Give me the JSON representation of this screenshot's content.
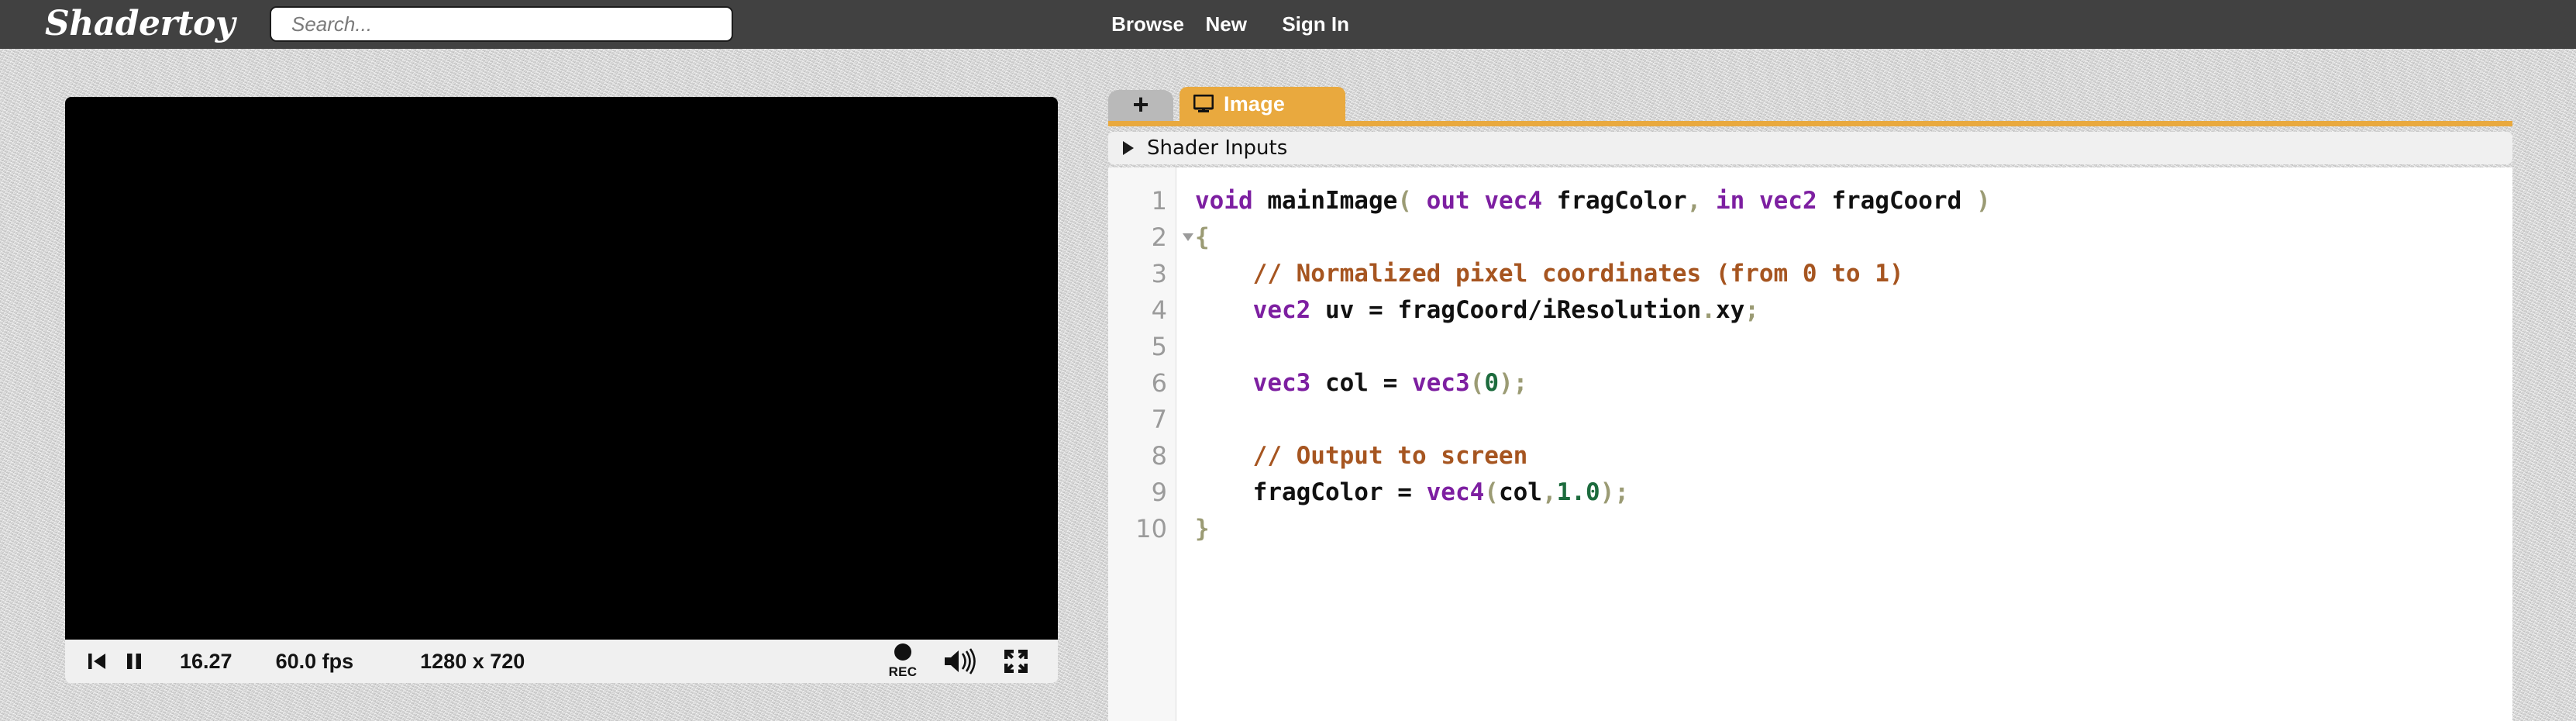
{
  "header": {
    "logo": "Shadertoy",
    "search": {
      "placeholder": "Search...",
      "value": ""
    },
    "nav": [
      {
        "label": "Browse",
        "name": "nav-browse"
      },
      {
        "label": "New",
        "name": "nav-new"
      },
      {
        "label": "Sign In",
        "name": "nav-signin"
      }
    ]
  },
  "preview": {
    "canvas_color": "#000000",
    "player": {
      "rewind_icon": "skip-back-icon",
      "pause_icon": "pause-icon",
      "time": "16.27",
      "fps": "60.0 fps",
      "resolution": "1280 x 720",
      "record_label": "REC",
      "record_icon": "record-icon",
      "volume_icon": "volume-icon",
      "fullscreen_icon": "fullscreen-icon"
    }
  },
  "code_panel": {
    "add_tab_label": "+",
    "tabs": [
      {
        "label": "Image",
        "icon": "monitor-icon",
        "active": true
      }
    ],
    "shader_inputs": {
      "label": "Shader Inputs",
      "arrow_icon": "triangle-right-icon",
      "expanded": false
    },
    "accent_color": "#e9a93e",
    "editor": {
      "line_numbers": [
        "1",
        "2",
        "3",
        "4",
        "5",
        "6",
        "7",
        "8",
        "9",
        "10"
      ],
      "fold_line": "2",
      "lines": [
        {
          "n": "1",
          "tokens": [
            {
              "t": "void",
              "c": "kw"
            },
            {
              "t": " ",
              "c": "op"
            },
            {
              "t": "mainImage",
              "c": "fn"
            },
            {
              "t": "(",
              "c": "punc"
            },
            {
              "t": " ",
              "c": "op"
            },
            {
              "t": "out",
              "c": "kw"
            },
            {
              "t": " ",
              "c": "op"
            },
            {
              "t": "vec4",
              "c": "kw"
            },
            {
              "t": " ",
              "c": "op"
            },
            {
              "t": "fragColor",
              "c": "fn"
            },
            {
              "t": ",",
              "c": "punc"
            },
            {
              "t": " ",
              "c": "op"
            },
            {
              "t": "in",
              "c": "kw"
            },
            {
              "t": " ",
              "c": "op"
            },
            {
              "t": "vec2",
              "c": "kw"
            },
            {
              "t": " ",
              "c": "op"
            },
            {
              "t": "fragCoord",
              "c": "fn"
            },
            {
              "t": " ",
              "c": "op"
            },
            {
              "t": ")",
              "c": "punc"
            }
          ]
        },
        {
          "n": "2",
          "tokens": [
            {
              "t": "{",
              "c": "punc"
            }
          ]
        },
        {
          "n": "3",
          "tokens": [
            {
              "t": "    // Normalized pixel coordinates (from 0 to 1)",
              "c": "comment"
            }
          ]
        },
        {
          "n": "4",
          "tokens": [
            {
              "t": "    ",
              "c": "op"
            },
            {
              "t": "vec2",
              "c": "kw"
            },
            {
              "t": " ",
              "c": "op"
            },
            {
              "t": "uv",
              "c": "fn"
            },
            {
              "t": " = ",
              "c": "op"
            },
            {
              "t": "fragCoord",
              "c": "fn"
            },
            {
              "t": "/",
              "c": "op"
            },
            {
              "t": "iResolution",
              "c": "fn"
            },
            {
              "t": ".",
              "c": "punc"
            },
            {
              "t": "xy",
              "c": "fn"
            },
            {
              "t": ";",
              "c": "punc"
            }
          ]
        },
        {
          "n": "5",
          "tokens": []
        },
        {
          "n": "6",
          "tokens": [
            {
              "t": "    ",
              "c": "op"
            },
            {
              "t": "vec3",
              "c": "kw"
            },
            {
              "t": " ",
              "c": "op"
            },
            {
              "t": "col",
              "c": "fn"
            },
            {
              "t": " = ",
              "c": "op"
            },
            {
              "t": "vec3",
              "c": "kw"
            },
            {
              "t": "(",
              "c": "punc"
            },
            {
              "t": "0",
              "c": "num"
            },
            {
              "t": ")",
              "c": "punc"
            },
            {
              "t": ";",
              "c": "punc"
            }
          ]
        },
        {
          "n": "7",
          "tokens": []
        },
        {
          "n": "8",
          "tokens": [
            {
              "t": "    // Output to screen",
              "c": "comment"
            }
          ]
        },
        {
          "n": "9",
          "tokens": [
            {
              "t": "    ",
              "c": "op"
            },
            {
              "t": "fragColor",
              "c": "fn"
            },
            {
              "t": " = ",
              "c": "op"
            },
            {
              "t": "vec4",
              "c": "kw"
            },
            {
              "t": "(",
              "c": "punc"
            },
            {
              "t": "col",
              "c": "fn"
            },
            {
              "t": ",",
              "c": "punc"
            },
            {
              "t": "1.0",
              "c": "num"
            },
            {
              "t": ")",
              "c": "punc"
            },
            {
              "t": ";",
              "c": "punc"
            }
          ]
        },
        {
          "n": "10",
          "tokens": [
            {
              "t": "}",
              "c": "punc"
            }
          ]
        }
      ]
    }
  }
}
